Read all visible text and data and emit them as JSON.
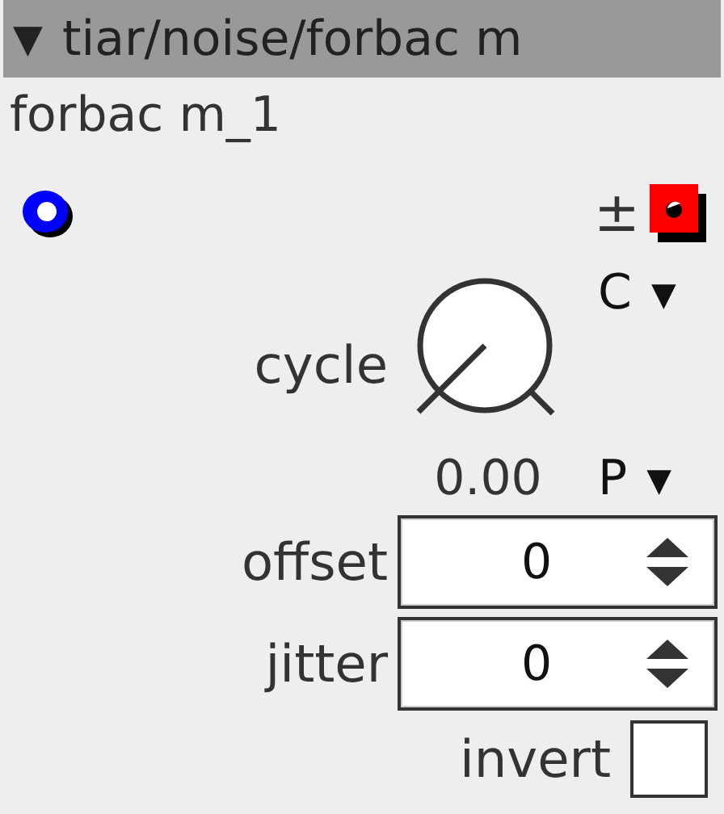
{
  "header": {
    "toggle": "▼",
    "title": "tiar/noise/forbac m",
    "expanded": true
  },
  "instance": "forbac m_1",
  "bipolar_symbol": "±",
  "knob": {
    "label": "cycle",
    "value": "0.00",
    "mode": "C",
    "mode_caret": "▼",
    "polarity": "P",
    "polarity_caret": "▼"
  },
  "fields": [
    {
      "label": "offset",
      "value": "0"
    },
    {
      "label": "jitter",
      "value": "0"
    }
  ],
  "checkbox": {
    "label": "invert",
    "checked": false
  }
}
